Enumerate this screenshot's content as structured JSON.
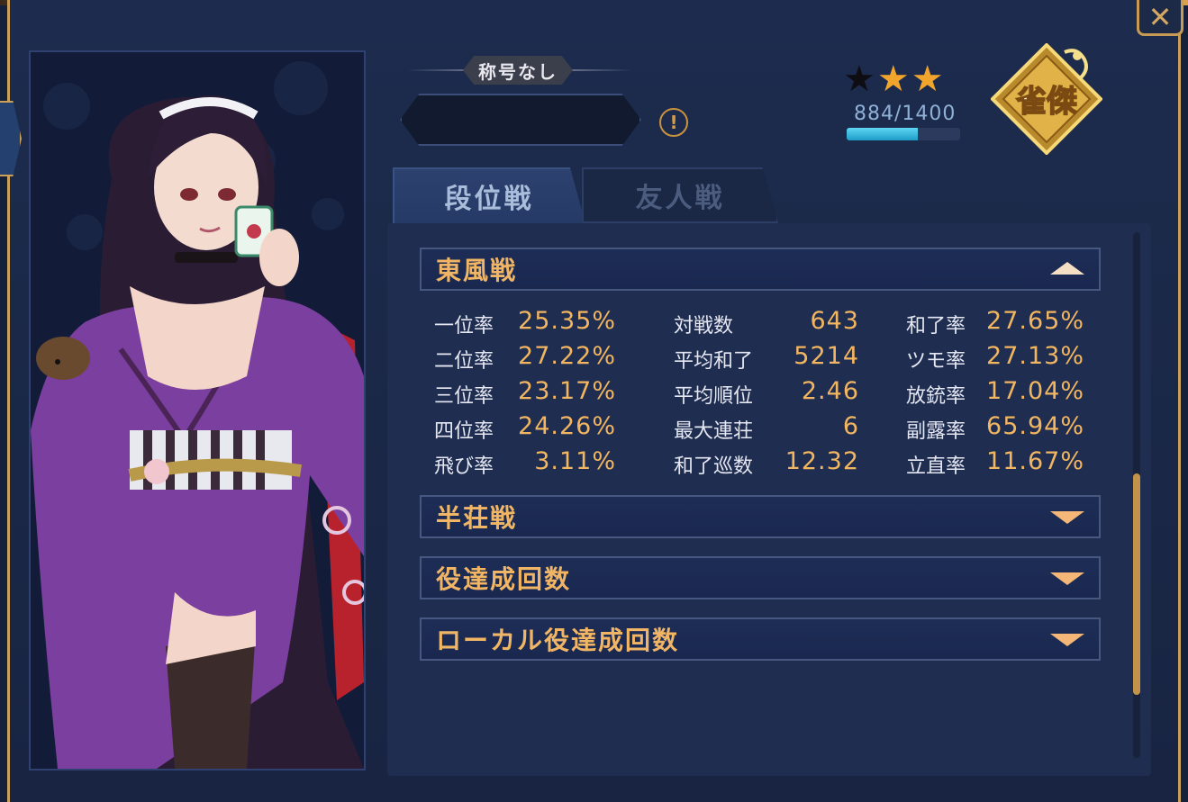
{
  "window": {
    "close_label": "✕"
  },
  "profile": {
    "title": "称号なし",
    "name": "",
    "info_icon": "!",
    "stars": [
      {
        "symbol": "★",
        "color": "#0d0d12"
      },
      {
        "symbol": "★",
        "color": "#f2a52c"
      },
      {
        "symbol": "★",
        "color": "#f2a52c"
      }
    ],
    "exp_text": "884/1400",
    "exp_progress": 0.63,
    "rank_text": "雀傑"
  },
  "tabs": [
    {
      "label": "段位戦",
      "active": true
    },
    {
      "label": "友人戦",
      "active": false
    }
  ],
  "sections": {
    "tonpu": {
      "label": "東風戦",
      "expanded": true
    },
    "hanchan": {
      "label": "半荘戦",
      "expanded": false
    },
    "yaku": {
      "label": "役達成回数",
      "expanded": false
    },
    "local_yaku": {
      "label": "ローカル役達成回数",
      "expanded": false
    }
  },
  "stats": {
    "col1": [
      {
        "label": "一位率",
        "value": "25.35%"
      },
      {
        "label": "二位率",
        "value": "27.22%"
      },
      {
        "label": "三位率",
        "value": "23.17%"
      },
      {
        "label": "四位率",
        "value": "24.26%"
      },
      {
        "label": "飛び率",
        "value": "3.11%"
      }
    ],
    "col2": [
      {
        "label": "対戦数",
        "value": "643"
      },
      {
        "label": "平均和了",
        "value": "5214"
      },
      {
        "label": "平均順位",
        "value": "2.46"
      },
      {
        "label": "最大連荘",
        "value": "6"
      },
      {
        "label": "和了巡数",
        "value": "12.32"
      }
    ],
    "col3": [
      {
        "label": "和了率",
        "value": "27.65%"
      },
      {
        "label": "ツモ率",
        "value": "27.13%"
      },
      {
        "label": "放銃率",
        "value": "17.04%"
      },
      {
        "label": "副露率",
        "value": "65.94%"
      },
      {
        "label": "立直率",
        "value": "11.67%"
      }
    ]
  },
  "colors": {
    "accent_gold": "#f2b560",
    "panel": "#1f2d50",
    "frame_gold": "#caa05a",
    "exp_fill": "#2ab4dc"
  }
}
